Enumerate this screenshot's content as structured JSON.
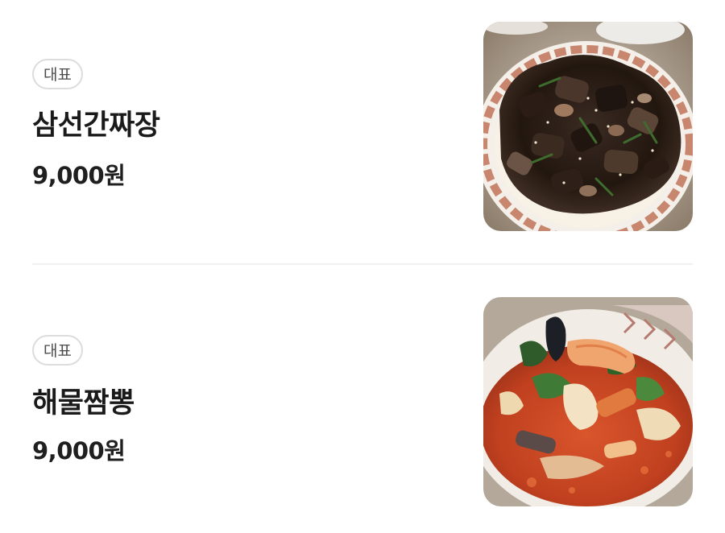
{
  "menu": {
    "items": [
      {
        "badge": "대표",
        "name": "삼선간짜장",
        "price": "9,000원",
        "photo": "jjajang-noodle-photo"
      },
      {
        "badge": "대표",
        "name": "해물짬뽕",
        "price": "9,000원",
        "photo": "seafood-jjamppong-photo"
      }
    ]
  },
  "colors": {
    "text": "#1a1a1a",
    "badge_border": "#dcdcdc",
    "divider": "#f0f0f0"
  }
}
